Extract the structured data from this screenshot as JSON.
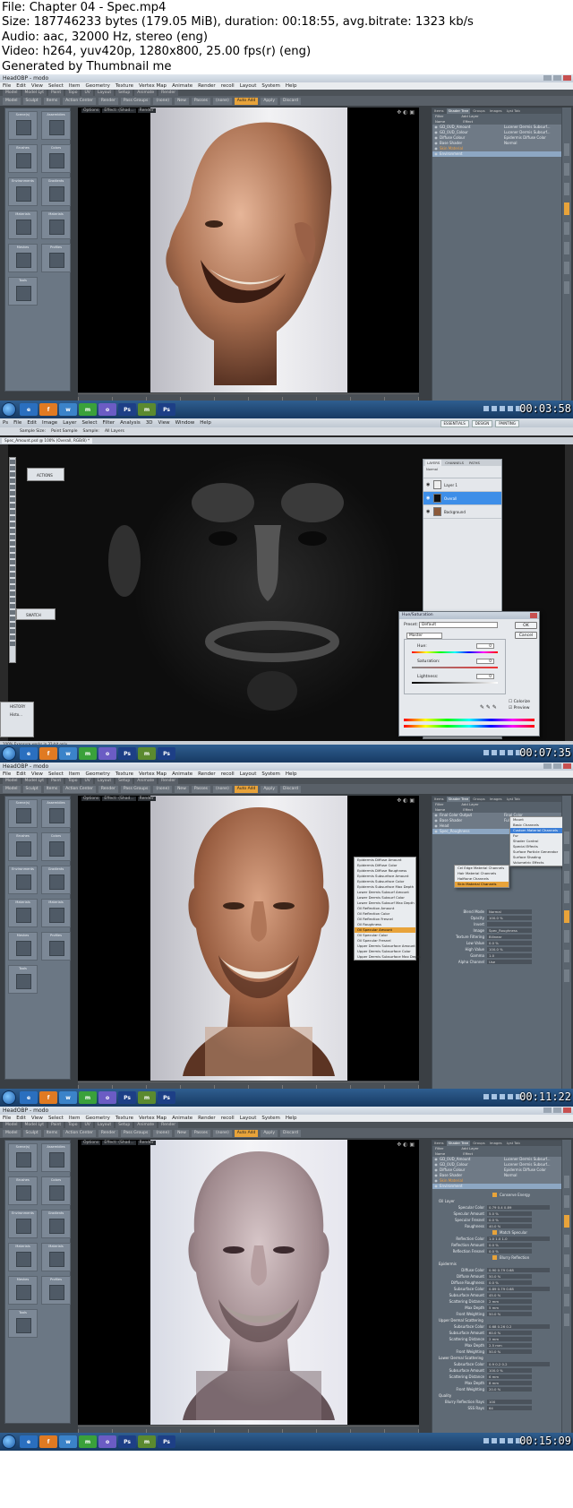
{
  "header": {
    "file_line": "File: Chapter 04 - Spec.mp4",
    "size_line": "Size: 187746233 bytes (179.05 MiB), duration: 00:18:55, avg.bitrate: 1323 kb/s",
    "audio_line": "Audio: aac, 32000 Hz, stereo (eng)",
    "video_line": "Video: h264, yuv420p, 1280x800, 25.00 fps(r) (eng)",
    "generator_line": "Generated by Thumbnail me"
  },
  "modo": {
    "window_title": "HeadOBP - modo",
    "menu": [
      "File",
      "Edit",
      "View",
      "Select",
      "Item",
      "Geometry",
      "Texture",
      "Vertex Map",
      "Animate",
      "Render",
      "recoll",
      "Layout",
      "System",
      "Help"
    ],
    "layout_tabs": [
      "Model",
      "Model Lyt",
      "Paint",
      "Topo",
      "UV",
      "Layout",
      "Setup",
      "Animate",
      "Render"
    ],
    "toolbar": {
      "model": "Model",
      "sculpt": "Sculpt",
      "items": "Items",
      "action_center": "Action Center",
      "render": "Render",
      "pass_groups": "Pass Groups",
      "none1": "(none)",
      "new": "New",
      "passes": "Passes",
      "none2": "(none)",
      "auto_add": "Auto Add",
      "apply": "Apply",
      "discard": "Discard"
    },
    "viewport_tabs": [
      "Options",
      "Effect: (Shad...",
      "Render"
    ],
    "presets": [
      "Scene(s)",
      "Assemblies",
      "Brushes",
      "Colors",
      "Environments",
      "Gradients",
      "Materials",
      "Materials",
      "Meshes",
      "Profiles",
      "Tools"
    ],
    "shader_tabs": [
      "Items",
      "Shader Tree",
      "Groups",
      "Images",
      "Lyst Tab"
    ],
    "shader_header": {
      "filter": "Filter",
      "add_layer": "Add Layer",
      "name": "Name",
      "effect": "Effect"
    },
    "tree_rows_1": [
      {
        "name": "GD_0UD_Amount",
        "effect": "Lucener Dermis Subsurf...",
        "state": ""
      },
      {
        "name": "GD_0UD_Colour",
        "effect": "Lucener Dermis Subsurf...",
        "state": ""
      },
      {
        "name": "Diffuse Colour",
        "effect": "Epidermis Diffuse Color",
        "state": ""
      },
      {
        "name": "Base Shader",
        "effect": "Normal",
        "state": ""
      },
      {
        "name": "Skin Material",
        "effect": "",
        "state": "orange"
      },
      {
        "name": "Environment",
        "effect": "",
        "state": "sel"
      }
    ],
    "tree_rows_3": [
      {
        "name": "Final Color Output",
        "effect": "Final Color",
        "state": ""
      },
      {
        "name": "Base Shader",
        "effect": "Full Shading",
        "state": ""
      },
      {
        "name": "Head",
        "effect": "",
        "state": ""
      },
      {
        "name": "Spec_Roughness",
        "effect": "",
        "state": "sel"
      }
    ],
    "popup_menu_a": [
      "Mount",
      "Basic Channels",
      "Custom Material Channels",
      "Fur",
      "Shader Control",
      "Special Effects",
      "Surface Particle Generator",
      "Surface Shading",
      "Volumetric Effects"
    ],
    "popup_menu_b": [
      "Cel Edge Material Channels",
      "Hair Material Channels",
      "Halftone Channels",
      "Skin Material Channels"
    ],
    "popup_menu_c": [
      "Epidermis Diffuse Amount",
      "Epidermis Diffuse Color",
      "Epidermis Diffuse Roughness",
      "Epidermis Subsurface Amount",
      "Epidermis Subsurface Color",
      "Epidermis Subsurface Max Depth",
      "Lower Dermis Subsurf Amount",
      "Lower Dermis Subsurf Color",
      "Lower Dermis Subsurf Max Depth",
      "Oil Reflection Amount",
      "Oil Reflection Color",
      "Oil Reflection Fresnel",
      "Oil Roughness",
      "Oil Specular Amount",
      "Oil Specular Color",
      "Oil Specular Fresnel",
      "Upper Dermis Subsurface Amount",
      "Upper Dermis Subsurface Color",
      "Upper Dermis Subsurface Max Depth"
    ],
    "props_3": [
      {
        "key": "Blend Mode",
        "val": "Normal"
      },
      {
        "key": "Opacity",
        "val": "100.0 %"
      },
      {
        "key": "Invert",
        "val": ""
      },
      {
        "key": "Image",
        "val": "Spec_Roughness"
      },
      {
        "key": "Texture Filtering",
        "val": "Bilinear"
      },
      {
        "key": "Low Value",
        "val": "0.0 %"
      },
      {
        "key": "High Value",
        "val": "100.0 %"
      },
      {
        "key": "Gamma",
        "val": "1.0"
      },
      {
        "key": "Alpha Channel",
        "val": "Use"
      }
    ],
    "props_4": [
      {
        "key": "Conserve Energy",
        "val": "",
        "type": "check"
      },
      {
        "key": "Oil Layer",
        "val": "",
        "type": "section"
      },
      {
        "key": "Specular Color",
        "val": "0.79   0.4   0.89",
        "type": "color"
      },
      {
        "key": "Specular Amount",
        "val": "5.0 %"
      },
      {
        "key": "Specular Fresnel",
        "val": "0.0 %"
      },
      {
        "key": "Roughness",
        "val": "40.0 %"
      },
      {
        "key": "Match Specular",
        "val": "",
        "type": "check"
      },
      {
        "key": "Reflection Color",
        "val": "1.0   1.0   1.0",
        "type": "color"
      },
      {
        "key": "Reflection Amount",
        "val": "0.0 %"
      },
      {
        "key": "Reflection Fresnel",
        "val": "0.0 %"
      },
      {
        "key": "Blurry Reflection",
        "val": "",
        "type": "check"
      },
      {
        "key": "Epidermis",
        "val": "",
        "type": "section"
      },
      {
        "key": "Diffuse Color",
        "val": "0.90   0.79   0.68",
        "type": "color"
      },
      {
        "key": "Diffuse Amount",
        "val": "50.0 %"
      },
      {
        "key": "Diffuse Roughness",
        "val": "0.0 %"
      },
      {
        "key": "Subsurface Color",
        "val": "0.89   0.79   0.68",
        "type": "color"
      },
      {
        "key": "Subsurface Amount",
        "val": "45.0 %"
      },
      {
        "key": "Scattering Distance",
        "val": "2 mm"
      },
      {
        "key": "Max Depth",
        "val": "5 mm"
      },
      {
        "key": "Front Weighting",
        "val": "50.0 %"
      },
      {
        "key": "Upper Dermal Scattering",
        "val": "",
        "type": "section"
      },
      {
        "key": "Subsurface Color",
        "val": "0.68   0.26   0.2",
        "type": "color"
      },
      {
        "key": "Subsurface Amount",
        "val": "60.0 %"
      },
      {
        "key": "Scattering Distance",
        "val": "2 mm"
      },
      {
        "key": "Max Depth",
        "val": "2.5 mm"
      },
      {
        "key": "Front Weighting",
        "val": "50.0 %"
      },
      {
        "key": "Lower Dermal Scattering",
        "val": "",
        "type": "section"
      },
      {
        "key": "Subsurface Color",
        "val": "0.9   0.2   0.2",
        "type": "color"
      },
      {
        "key": "Subsurface Amount",
        "val": "100.0 %"
      },
      {
        "key": "Scattering Distance",
        "val": "6 mm"
      },
      {
        "key": "Max Depth",
        "val": "8 mm"
      },
      {
        "key": "Front Weighting",
        "val": "20.0 %"
      },
      {
        "key": "Quality",
        "val": "",
        "type": "section"
      },
      {
        "key": "Blurry Reflection Rays",
        "val": "100"
      },
      {
        "key": "SSS Rays",
        "val": "64"
      }
    ],
    "playbar": [
      "Options...",
      "Auto Key",
      "Animated"
    ]
  },
  "photoshop": {
    "menu": [
      "Ps",
      "File",
      "Edit",
      "Image",
      "Layer",
      "Select",
      "Filter",
      "Analysis",
      "3D",
      "View",
      "Window",
      "Help"
    ],
    "workspaces": [
      "ESSENTIALS",
      "DESIGN",
      "PAINTING"
    ],
    "options_bar": [
      "Sample Size:",
      "Point Sample",
      "Sample:",
      "All Layers"
    ],
    "doc_tab": "Spec_Amount.psd @ 100% (Overall, RGB/8) *",
    "panels_left": [
      "ACTIONS",
      "SWATCH",
      "HISTORY",
      "Histo..."
    ],
    "layers_tabs": [
      "LAYERS",
      "CHANNELS",
      "PATHS"
    ],
    "layers_mode": "Normal",
    "layers": [
      {
        "name": "Layer 1",
        "sel": false
      },
      {
        "name": "Overall",
        "sel": true
      },
      {
        "name": "Background",
        "sel": false
      }
    ],
    "status": "100%     Exposure works in 32-bit only",
    "hue_sat": {
      "title": "Hue/Saturation",
      "preset_label": "Preset:",
      "preset_value": "Default",
      "channel": "Master",
      "hue_label": "Hue:",
      "hue_value": "0",
      "sat_label": "Saturation:",
      "sat_value": "0",
      "light_label": "Lightness:",
      "light_value": "0",
      "ok": "OK",
      "cancel": "Cancel",
      "colorize": "Colorize",
      "preview": "Preview"
    }
  },
  "taskbar": {
    "clock1": "00:03:58",
    "clock2": "00:07:35",
    "clock3": "00:11:22",
    "clock4": "00:15:09",
    "apps": [
      "e",
      "f",
      "w",
      "m",
      "o",
      "Ps",
      "m",
      "Ps"
    ]
  },
  "colors": {
    "modo_accent": "#e8a33a",
    "taskbar_top": "#2f5e8f",
    "taskbar_bottom": "#173a63",
    "selection_blue": "#3d8ee8"
  }
}
